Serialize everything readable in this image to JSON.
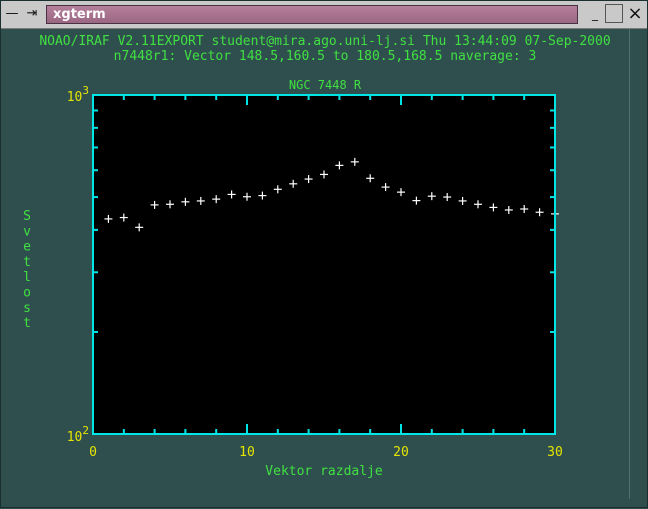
{
  "window": {
    "title": "xgterm",
    "buttons": {
      "minimize": "_",
      "close": "×"
    }
  },
  "header": {
    "line1": "NOAO/IRAF V2.11EXPORT student@mira.ago.uni-lj.si Thu 13:44:09 07-Sep-2000",
    "line2": "n7448r1: Vector 148.5,160.5 to 180.5,168.5 naverage: 3"
  },
  "colors": {
    "background": "#2f4f4f",
    "plot_area": "#000000",
    "frame": "#00e5e5",
    "text": "#40e040",
    "tick_labels": "#e5e500",
    "markers": "#ffffff"
  },
  "chart_data": {
    "type": "scatter",
    "title": "NGC 7448 R",
    "xlabel": "Vektor razdalje",
    "ylabel": "Svetlost",
    "xlim": [
      0,
      30
    ],
    "ylim": [
      100,
      1000
    ],
    "y_scale": "log",
    "grid": false,
    "marker": "+",
    "x_ticks": [
      0,
      10,
      20,
      30
    ],
    "x_tick_labels": [
      "0",
      "10",
      "20",
      "30"
    ],
    "y_tick_labels": [
      {
        "value": 1000,
        "base": "10",
        "exp": "3"
      },
      {
        "value": 100,
        "base": "10",
        "exp": "2"
      }
    ],
    "x": [
      1,
      2,
      3,
      4,
      5,
      6,
      7,
      8,
      9,
      10,
      11,
      12,
      13,
      14,
      15,
      16,
      17,
      18,
      19,
      20,
      21,
      22,
      23,
      24,
      25,
      26,
      27,
      28,
      29,
      30
    ],
    "y": [
      431,
      435,
      407,
      474,
      476,
      484,
      487,
      493,
      509,
      501,
      505,
      527,
      547,
      565,
      583,
      620,
      635,
      568,
      535,
      517,
      488,
      503,
      500,
      487,
      476,
      466,
      458,
      461,
      451,
      446
    ]
  }
}
